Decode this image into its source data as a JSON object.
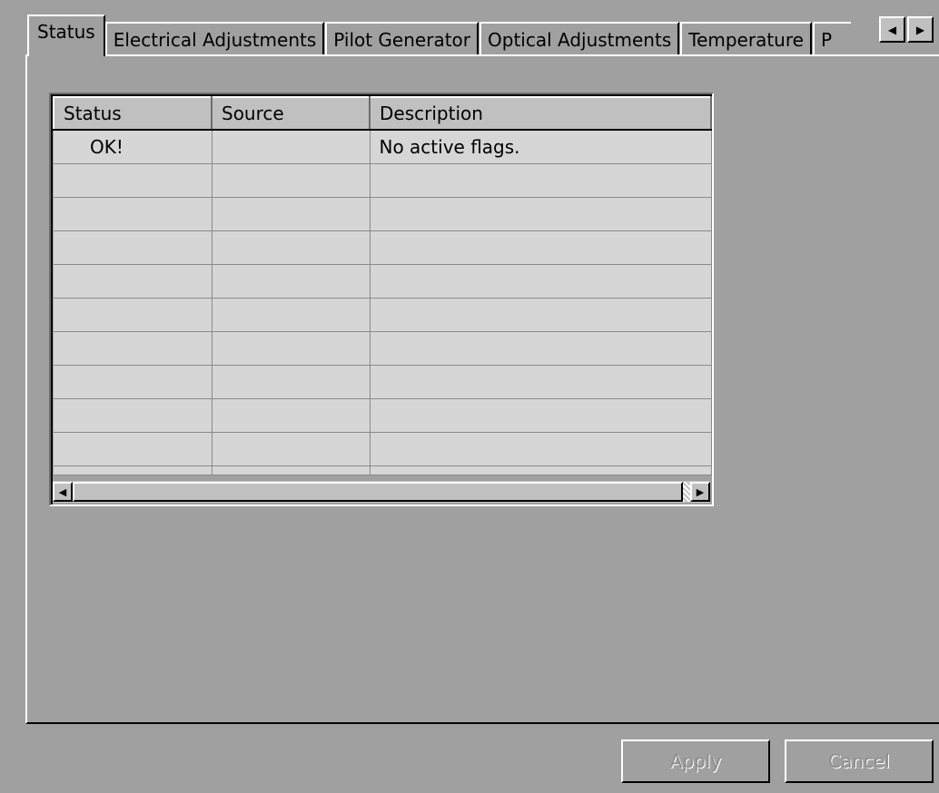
{
  "tabs": [
    {
      "label": "Status",
      "active": true
    },
    {
      "label": "Electrical Adjustments",
      "active": false
    },
    {
      "label": "Pilot Generator",
      "active": false
    },
    {
      "label": "Optical Adjustments",
      "active": false
    },
    {
      "label": "Temperature",
      "active": false
    },
    {
      "label": "P",
      "active": false
    }
  ],
  "tab_scroll": {
    "left_icon": "scroll-left-arrow",
    "right_icon": "scroll-right-arrow"
  },
  "grid": {
    "columns": [
      "Status",
      "Source",
      "Description"
    ],
    "rows": [
      {
        "status": "OK!",
        "source": "",
        "description": "No active flags."
      },
      {
        "status": "",
        "source": "",
        "description": ""
      },
      {
        "status": "",
        "source": "",
        "description": ""
      },
      {
        "status": "",
        "source": "",
        "description": ""
      },
      {
        "status": "",
        "source": "",
        "description": ""
      },
      {
        "status": "",
        "source": "",
        "description": ""
      },
      {
        "status": "",
        "source": "",
        "description": ""
      },
      {
        "status": "",
        "source": "",
        "description": ""
      },
      {
        "status": "",
        "source": "",
        "description": ""
      },
      {
        "status": "",
        "source": "",
        "description": ""
      }
    ]
  },
  "buttons": {
    "apply": {
      "label": "Apply",
      "enabled": false
    },
    "cancel": {
      "label": "Cancel",
      "enabled": false
    }
  },
  "colors": {
    "background": "#a0a0a0",
    "cell_background": "#d6d6d6",
    "disabled_text": "#8c8c8c"
  }
}
